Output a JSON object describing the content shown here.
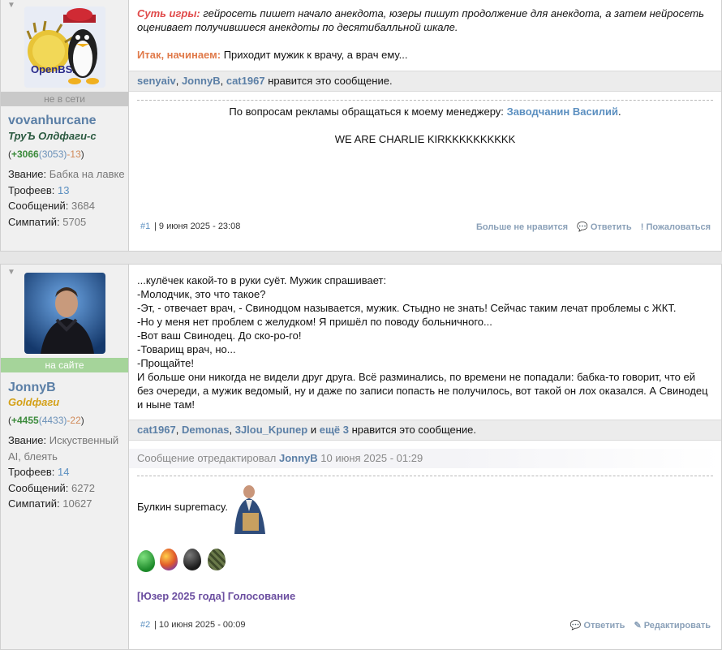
{
  "posts": [
    {
      "user": {
        "name": "vovanhurcane",
        "title": "ТруЪ Олдфаги-с",
        "title_color": "#2b5a40",
        "status": "не в сети",
        "rep_plus": "+3066",
        "rep_mid": "3053",
        "rep_minus": "-13",
        "rank_label": "Звание:",
        "rank": "Бабка на лавке",
        "trophies_label": "Трофеев:",
        "trophies": "13",
        "messages_label": "Сообщений:",
        "messages": "3684",
        "likes_label": "Симпатий:",
        "likes": "5705",
        "avatar_icon": "openbsd-penguin-avatar"
      },
      "text_intro_label": "Суть игры:",
      "text_intro": "гейросеть пишет начало анекдота, юзеры пишут продолжение для анекдота, а затем нейросеть оценивает получившиеся анекдоты по десятибалльной шкале.",
      "text_start_label": "Итак, начинаем:",
      "text_start": "Приходит мужик к врачу, а врач ему...",
      "liked_by": [
        "senyaiv",
        "JonnyB",
        "cat1967"
      ],
      "liked_suffix": "нравится это сообщение.",
      "signature_prefix": "По вопросам рекламы обращаться к моему менеджеру:",
      "signature_manager": "Заводчанин Василий",
      "signature_line2": "WE ARE CHARLIE KIRKKKKKKKKKK",
      "number": "#1",
      "date": "| 9 июня 2025 - 23:08",
      "action_unlike": "Больше не нравится",
      "action_reply": "Ответить",
      "action_report": "Пожаловаться"
    },
    {
      "user": {
        "name": "JonnyB",
        "title": "Goldфаги",
        "title_color": "#d4a017",
        "status": "на сайте",
        "rep_plus": "+4455",
        "rep_mid": "4433",
        "rep_minus": "-22",
        "rank_label": "Звание:",
        "rank": "Искуственный AI, блеять",
        "trophies_label": "Трофеев:",
        "trophies": "14",
        "messages_label": "Сообщений:",
        "messages": "6272",
        "likes_label": "Симпатий:",
        "likes": "10627",
        "avatar_icon": "man-photo-avatar"
      },
      "lines": [
        "...кулёчек какой-то в руки суёт. Мужик спрашивает:",
        "-Молодчик, это что такое?",
        "-Эт, - отвечает врач, - Свинодцом называется, мужик. Стыдно не знать! Сейчас таким лечат проблемы с ЖКТ.",
        "-Но у меня нет проблем с желудком! Я пришёл по поводу больничного...",
        "-Вот ваш Свинодец. До ско-ро-го!",
        "-Товарищ врач, но...",
        "-Прощайте!",
        "И больше они никогда не видели друг друга. Всё разминались, по времени не попадали: бабка-то говорит, что ей без очереди, а мужик ведомый, ну и даже по записи попасть не получилось, вот такой он лох оказался. А Свинодец и ныне там!"
      ],
      "liked_by": [
        "cat1967",
        "Demonas",
        "3Jlou_Kpuпep"
      ],
      "liked_and": "и",
      "liked_more": "ещё 3",
      "liked_suffix": "нравится это сообщение.",
      "edited_prefix": "Сообщение отредактировал",
      "edited_user": "JonnyB",
      "edited_date": "10 июня 2025 - 01:29",
      "signature_text": "Булкин supremacy.",
      "vote_link": "[Юзер 2025 года] Голосование",
      "number": "#2",
      "date": "| 10 июня 2025 - 00:09",
      "action_reply": "Ответить",
      "action_edit": "Редактировать"
    }
  ],
  "colors": {
    "link": "#5b7fa6",
    "intro_label": "#e04a4a",
    "online": "#a5d49a",
    "offline": "#c9c9c9"
  }
}
